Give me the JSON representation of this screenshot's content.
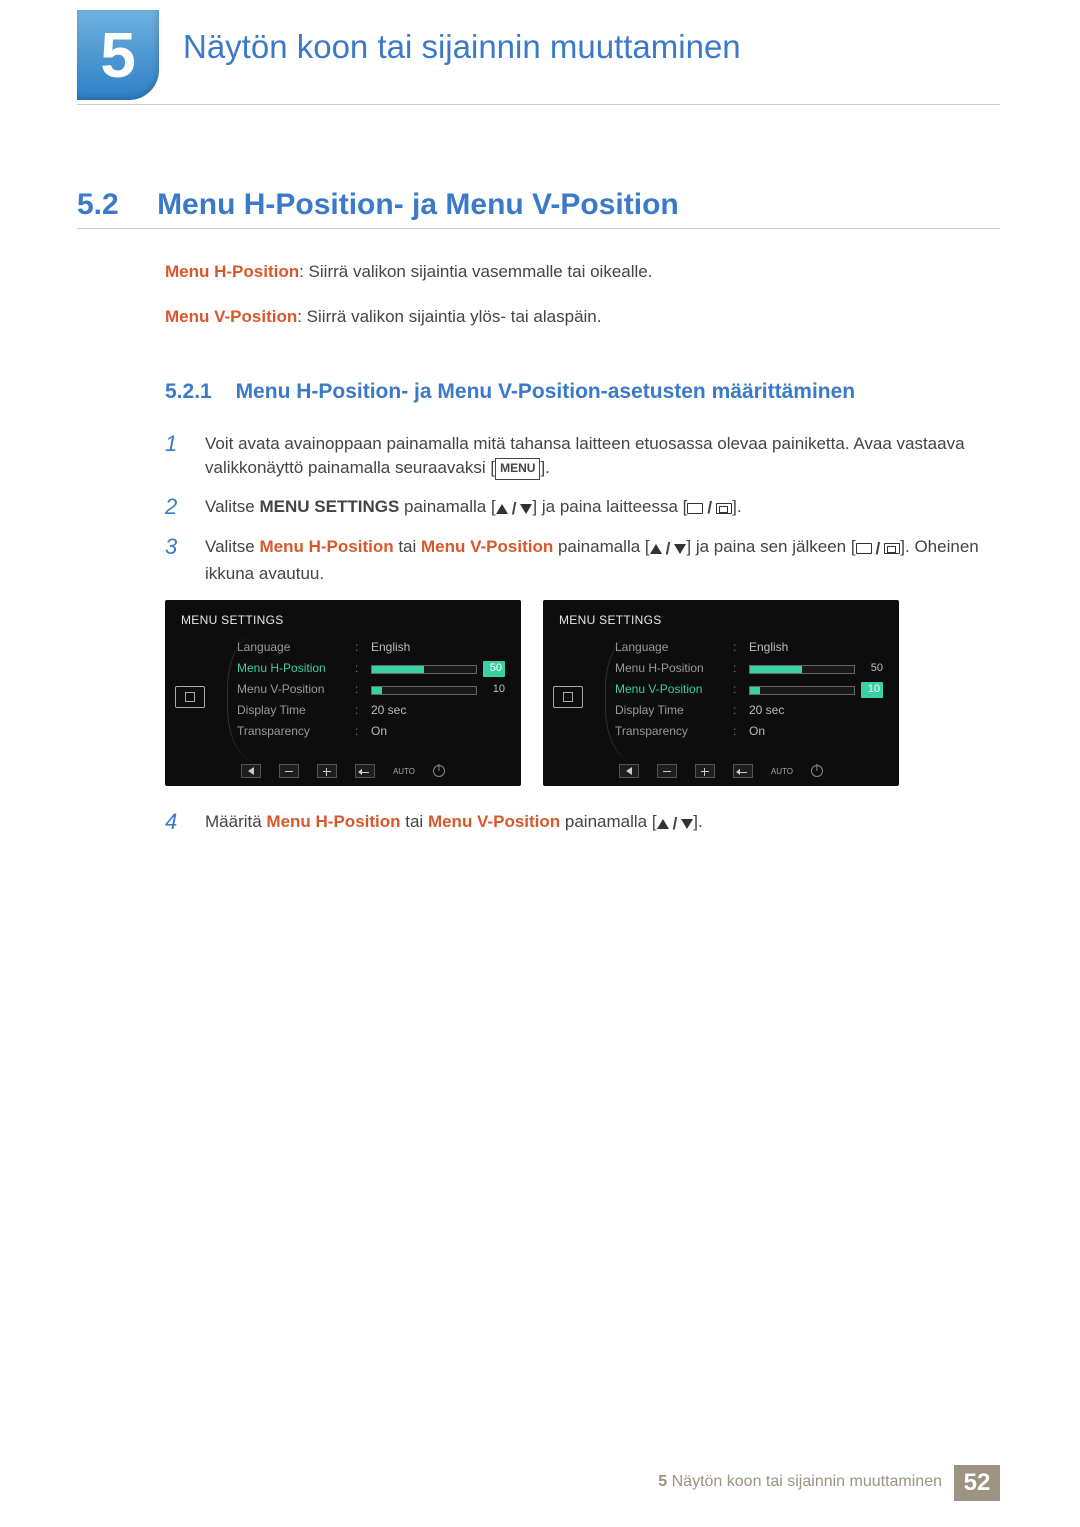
{
  "chapter": {
    "number": "5",
    "title": "Näytön koon tai sijainnin muuttaminen"
  },
  "section": {
    "number": "5.2",
    "title": "Menu H-Position- ja Menu V-Position"
  },
  "definitions": [
    {
      "term": "Menu H-Position",
      "desc": ": Siirrä valikon sijaintia vasemmalle tai oikealle."
    },
    {
      "term": "Menu V-Position",
      "desc": ": Siirrä valikon sijaintia ylös- tai alaspäin."
    }
  ],
  "subsection": {
    "number": "5.2.1",
    "title": "Menu H-Position- ja Menu V-Position-asetusten määrittäminen"
  },
  "steps": {
    "s1": {
      "text_a": "Voit avata avainoppaan painamalla mitä tahansa laitteen etuosassa olevaa painiketta. Avaa vastaava valikkonäyttö painamalla seuraavaksi [",
      "menu_key": "MENU",
      "text_b": "]."
    },
    "s2": {
      "text_a": "Valitse ",
      "bold": "MENU SETTINGS",
      "text_b": " painamalla [",
      "text_c": "] ja paina laitteessa [",
      "text_d": "]."
    },
    "s3": {
      "text_a": "Valitse ",
      "orange1": "Menu H-Position",
      "text_b": " tai ",
      "orange2": "Menu V-Position",
      "text_c": " painamalla [",
      "text_d": "] ja paina sen jälkeen [",
      "text_e": "]. Oheinen ikkuna avautuu."
    },
    "s4": {
      "text_a": "Määritä ",
      "orange1": "Menu H-Position",
      "text_b": " tai ",
      "orange2": "Menu V-Position",
      "text_c": " painamalla [",
      "text_d": "]."
    }
  },
  "osd": {
    "title": "MENU SETTINGS",
    "rows": {
      "language": {
        "label": "Language",
        "value": "English"
      },
      "hpos": {
        "label": "Menu H-Position",
        "value": "50",
        "fill_pct": 50
      },
      "vpos": {
        "label": "Menu V-Position",
        "value": "10",
        "fill_pct": 10
      },
      "display": {
        "label": "Display Time",
        "value": "20 sec"
      },
      "transparency": {
        "label": "Transparency",
        "value": "On"
      }
    },
    "auto_label": "AUTO"
  },
  "footer": {
    "chapter_num": "5",
    "chapter_title": "Näytön koon tai sijainnin muuttaminen",
    "page": "52"
  }
}
